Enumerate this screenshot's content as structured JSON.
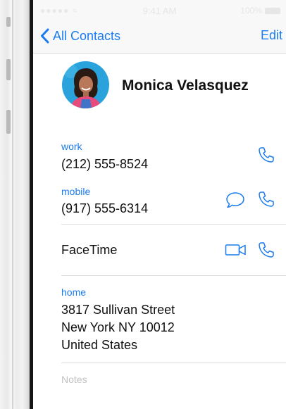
{
  "status_bar": {
    "signal": "●●●●● ≈",
    "time": "9:41 AM",
    "battery": "100%"
  },
  "nav": {
    "back_label": "All Contacts",
    "edit_label": "Edit"
  },
  "contact": {
    "name": "Monica Velasquez"
  },
  "phones": [
    {
      "label": "work",
      "number": "(212) 555-8524"
    },
    {
      "label": "mobile",
      "number": "(917) 555-6314"
    }
  ],
  "facetime": {
    "label": "FaceTime"
  },
  "address": {
    "label": "home",
    "line1": "3817 Sullivan Street",
    "line2": "New York NY 10012",
    "line3": "United States"
  },
  "notes": {
    "placeholder": "Notes"
  },
  "colors": {
    "accent": "#1a7cf0",
    "divider": "#dcdcdc",
    "placeholder": "#c2c2c2",
    "avatar_bg": "#2aa3dc"
  },
  "icons": {
    "back": "chevron-left-icon",
    "call": "phone-icon",
    "message": "message-bubble-icon",
    "video": "video-camera-icon"
  }
}
